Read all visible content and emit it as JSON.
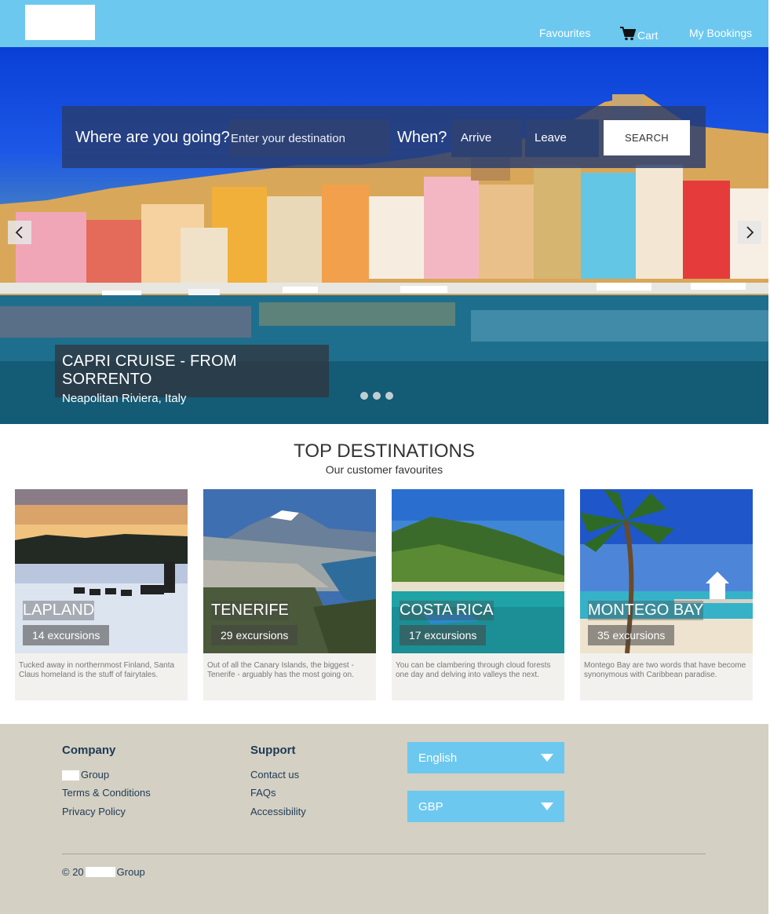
{
  "header": {
    "nav": {
      "favourites": "Favourites",
      "cart": "Cart",
      "bookings": "My Bookings"
    }
  },
  "search": {
    "where_label": "Where are you going?",
    "destination_placeholder": "Enter your destination",
    "when_label": "When?",
    "arrive": "Arrive",
    "leave": "Leave",
    "button": "SEARCH"
  },
  "hero": {
    "title": "CAPRI CRUISE - FROM SORRENTO",
    "subtitle": "Neapolitan Riviera, Italy",
    "slide_count": 3
  },
  "destinations": {
    "title": "TOP DESTINATIONS",
    "subtitle": "Our customer favourites",
    "cards": [
      {
        "name": "LAPLAND",
        "count": "14 excursions",
        "desc": "Tucked away in northernmost Finland, Santa Claus homeland is the stuff of fairytales."
      },
      {
        "name": "TENERIFE",
        "count": "29 excursions",
        "desc": "Out of all the Canary Islands, the biggest - Tenerife - arguably has the most going on."
      },
      {
        "name": "COSTA RICA",
        "count": "17 excursions",
        "desc": "You can be clambering through cloud forests one day and delving into valleys the next."
      },
      {
        "name": "MONTEGO BAY",
        "count": "35 excursions",
        "desc": "Montego Bay are two words that have become synonymous with Caribbean paradise."
      }
    ]
  },
  "footer": {
    "company": {
      "heading": "Company",
      "group": "Group",
      "terms": "Terms & Conditions",
      "privacy": "Privacy Policy"
    },
    "support": {
      "heading": "Support",
      "contact": "Contact us",
      "faqs": "FAQs",
      "accessibility": "Accessibility"
    },
    "language": "English",
    "currency": "GBP",
    "copyright_prefix": "© 20",
    "copyright_suffix": "Group"
  },
  "colors": {
    "brand": "#6cc8ef",
    "footer_bg": "#d4d0c3",
    "footer_text": "#1d3a56"
  }
}
